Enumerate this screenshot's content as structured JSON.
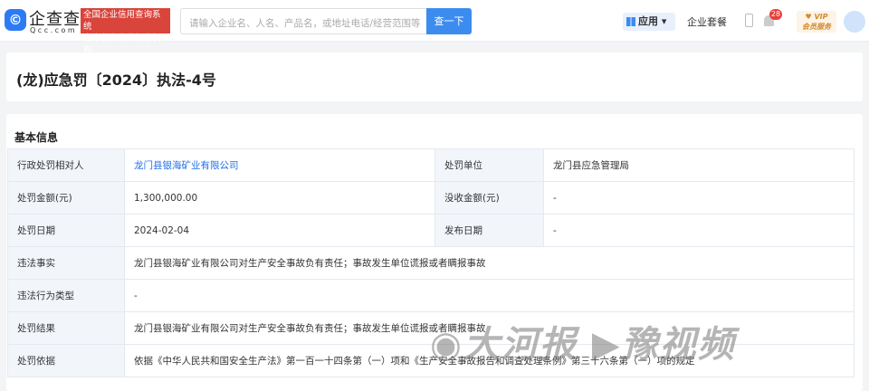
{
  "header": {
    "logo_glyph": "©",
    "brand": "企查查",
    "brand_sub": "Qcc.com",
    "badge_line1": "全国企业信用查询系统",
    "badge_line2": "官方备案企业征信机构",
    "search_placeholder": "请输入企业名、人名、产品名，或地址电话/经营范围等",
    "search_button": "查一下",
    "app_label": "应用 ▾",
    "package_label": "企业套餐",
    "notification_count": "28",
    "vip_line1": "♥ VIP",
    "vip_line2": "会员服务"
  },
  "title": "(龙)应急罚〔2024〕执法-4号",
  "section_title": "基本信息",
  "rows": [
    {
      "label": "行政处罚相对人",
      "value": "龙门县银海矿业有限公司",
      "label2": "处罚单位",
      "value2": "龙门县应急管理局"
    },
    {
      "label": "处罚金额(元)",
      "value": "1,300,000.00",
      "label2": "没收金额(元)",
      "value2": "-"
    },
    {
      "label": "处罚日期",
      "value": "2024-02-04",
      "label2": "发布日期",
      "value2": "-"
    }
  ],
  "full_rows": [
    {
      "label": "违法事实",
      "value": "龙门县银海矿业有限公司对生产安全事故负有责任；事故发生单位谎报或者瞒报事故"
    },
    {
      "label": "违法行为类型",
      "value": "-"
    },
    {
      "label": "处罚结果",
      "value": "龙门县银海矿业有限公司对生产安全事故负有责任；事故发生单位谎报或者瞒报事故"
    },
    {
      "label": "处罚依据",
      "value": "依据《中华人民共和国安全生产法》第一百一十四条第（一）项和《生产安全事故报告和调查处理条例》第三十六条第（一）项的规定"
    }
  ],
  "watermark": "◉大河报 ▶豫视频"
}
